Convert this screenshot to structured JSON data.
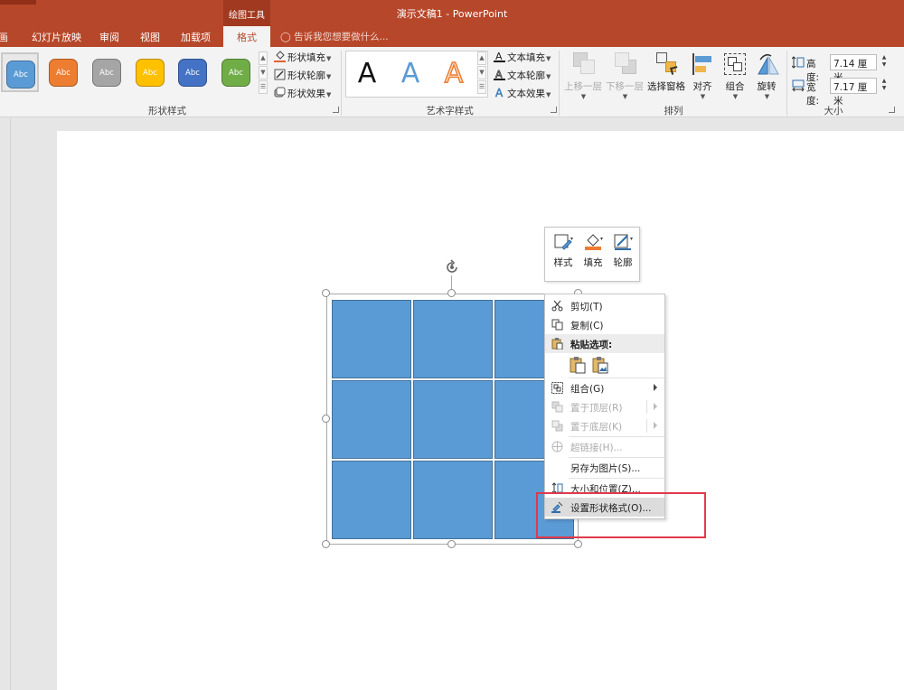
{
  "window": {
    "title": "演示文稿1 - PowerPoint",
    "context_tool": "绘图工具"
  },
  "tabs": [
    {
      "label": "画"
    },
    {
      "label": "幻灯片放映"
    },
    {
      "label": "审阅"
    },
    {
      "label": "视图"
    },
    {
      "label": "加载项"
    },
    {
      "label": "格式",
      "active": true
    }
  ],
  "tell_me": "告诉我您想要做什么...",
  "ribbon": {
    "shape_styles": {
      "label": "形状样式",
      "swatches": [
        {
          "text": "Abc",
          "color": "#5b9bd5"
        },
        {
          "text": "Abc",
          "color": "#ed7d31"
        },
        {
          "text": "Abc",
          "color": "#a5a5a5"
        },
        {
          "text": "Abc",
          "color": "#ffc000"
        },
        {
          "text": "Abc",
          "color": "#4472c4"
        },
        {
          "text": "Abc",
          "color": "#70ad47"
        }
      ],
      "fill": "形状填充",
      "outline": "形状轮廓",
      "effects": "形状效果"
    },
    "wordart": {
      "label": "艺术字样式",
      "samples": [
        "A",
        "A",
        "A"
      ],
      "text_fill": "文本填充",
      "text_outline": "文本轮廓",
      "text_effects": "文本效果"
    },
    "arrange": {
      "label": "排列",
      "bring_forward": "上移一层",
      "send_backward": "下移一层",
      "selection_pane": "选择窗格",
      "align": "对齐",
      "group": "组合",
      "rotate": "旋转"
    },
    "size": {
      "label": "大小",
      "height_label": "高度:",
      "height_value": "7.14 厘米",
      "width_label": "宽度:",
      "width_value": "7.17 厘米"
    }
  },
  "mini_toolbar": {
    "style": "样式",
    "fill": "填充",
    "outline": "轮廓"
  },
  "context_menu": {
    "cut": "剪切(T)",
    "copy": "复制(C)",
    "paste_options": "粘贴选项:",
    "group": "组合(G)",
    "bring_to_front": "置于顶层(R)",
    "send_to_back": "置于底层(K)",
    "hyperlink": "超链接(H)...",
    "save_as_picture": "另存为图片(S)...",
    "size_position": "大小和位置(Z)...",
    "format_shape": "设置形状格式(O)..."
  },
  "colors": {
    "accent": "#b7472a",
    "cell_fill": "#5b9bd5",
    "cell_border": "#41719c",
    "highlight_box": "#e0394a"
  }
}
